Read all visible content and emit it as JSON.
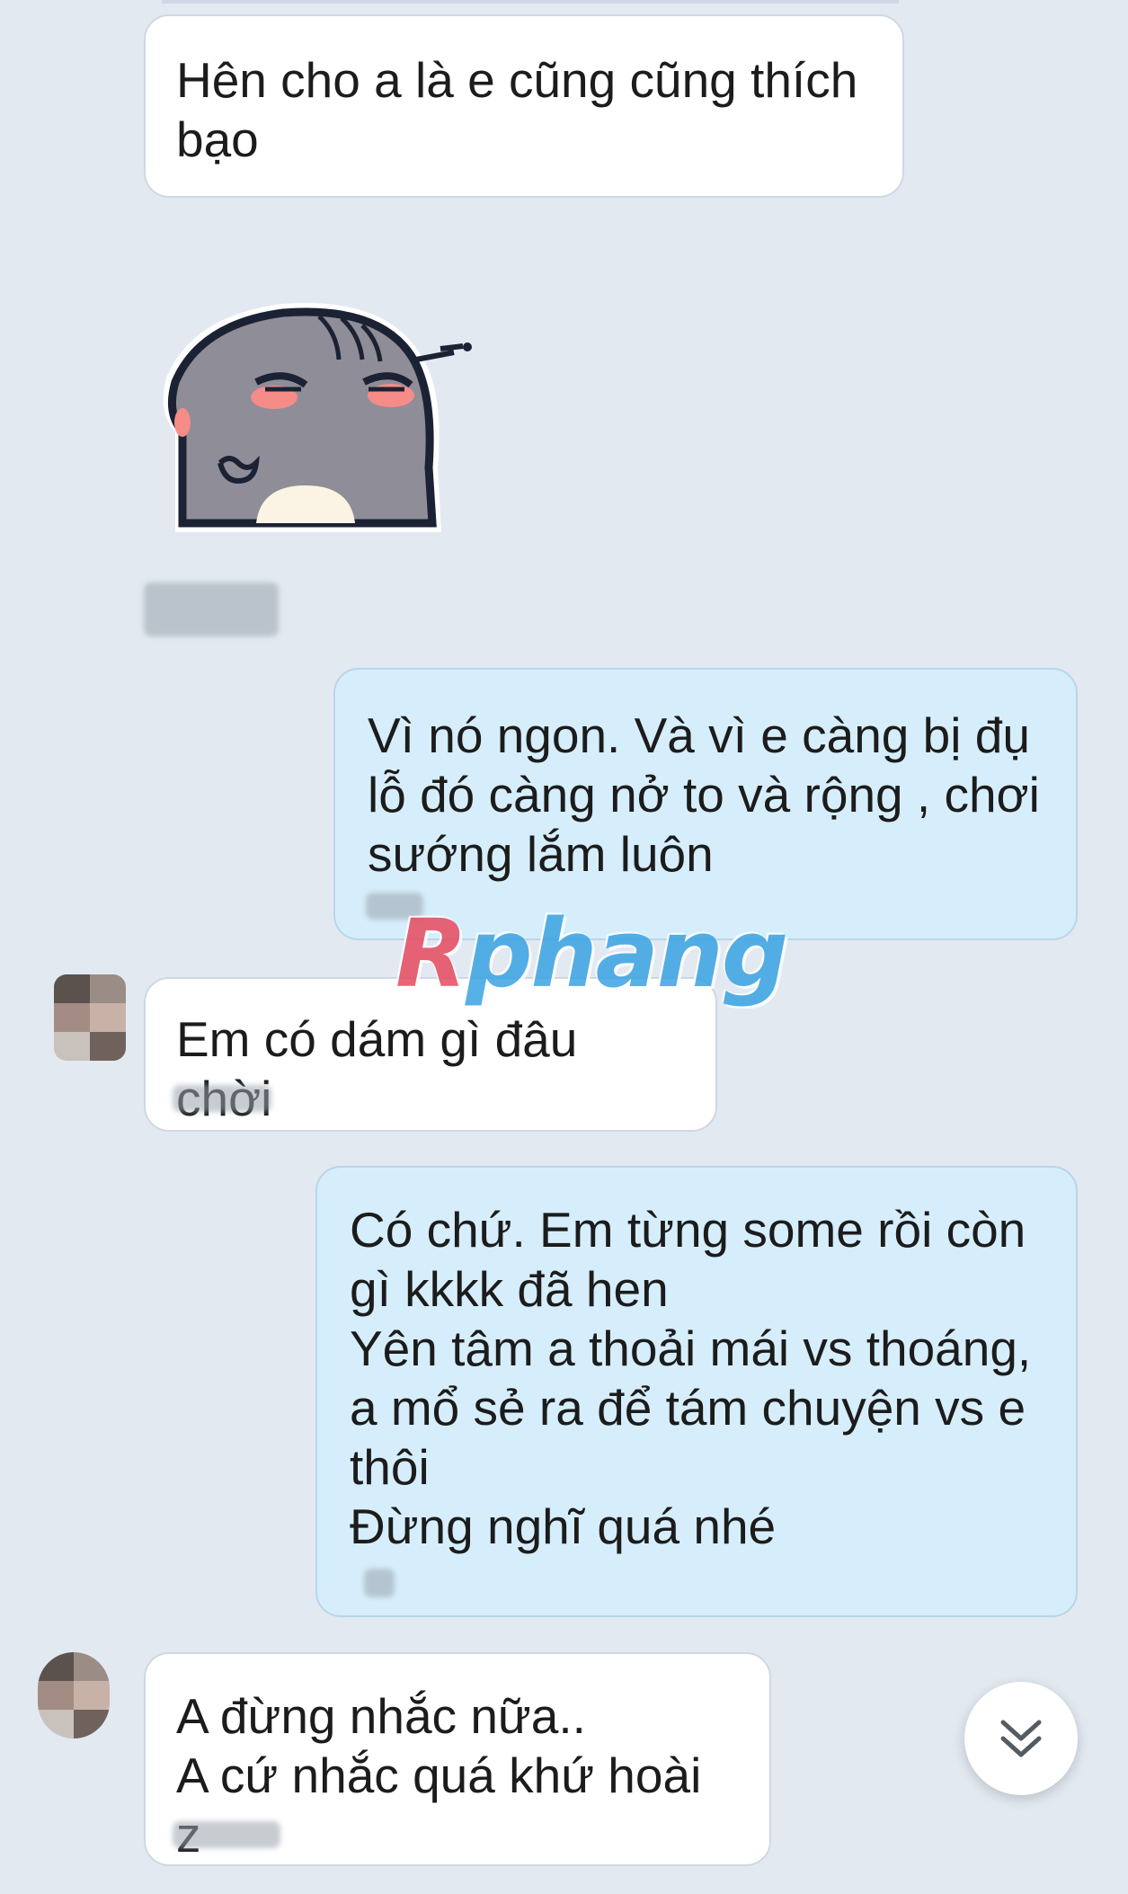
{
  "messages": [
    {
      "text": "Hên cho a là e cũng cũng thích\nbạo"
    },
    {
      "text": "Vì nó ngon. Và vì e càng bị đụ\nlỗ đó càng nở to và rộng , chơi\nsướng lắm luôn"
    },
    {
      "text": "Em có dám gì đâu chời"
    },
    {
      "text": "Có chứ. Em từng some rồi còn\ngì kkkk đã hen\nYên tâm a thoải mái vs thoáng,\na mổ sẻ ra để tám chuyện vs e\nthôi\nĐừng nghĩ quá nhé"
    },
    {
      "text": "A đừng nhắc nữa..\nA cứ nhắc quá khứ hoài z"
    }
  ],
  "sticker": {
    "icon": "grumpy-gray-creature-sticker"
  },
  "watermark": {
    "first": "R",
    "rest": "phang"
  },
  "scroll_button": {
    "icon": "double-chevron-down-icon"
  },
  "colors": {
    "background": "#e2e9f1",
    "incoming": "#ffffff",
    "outgoing": "#d6eefb"
  }
}
